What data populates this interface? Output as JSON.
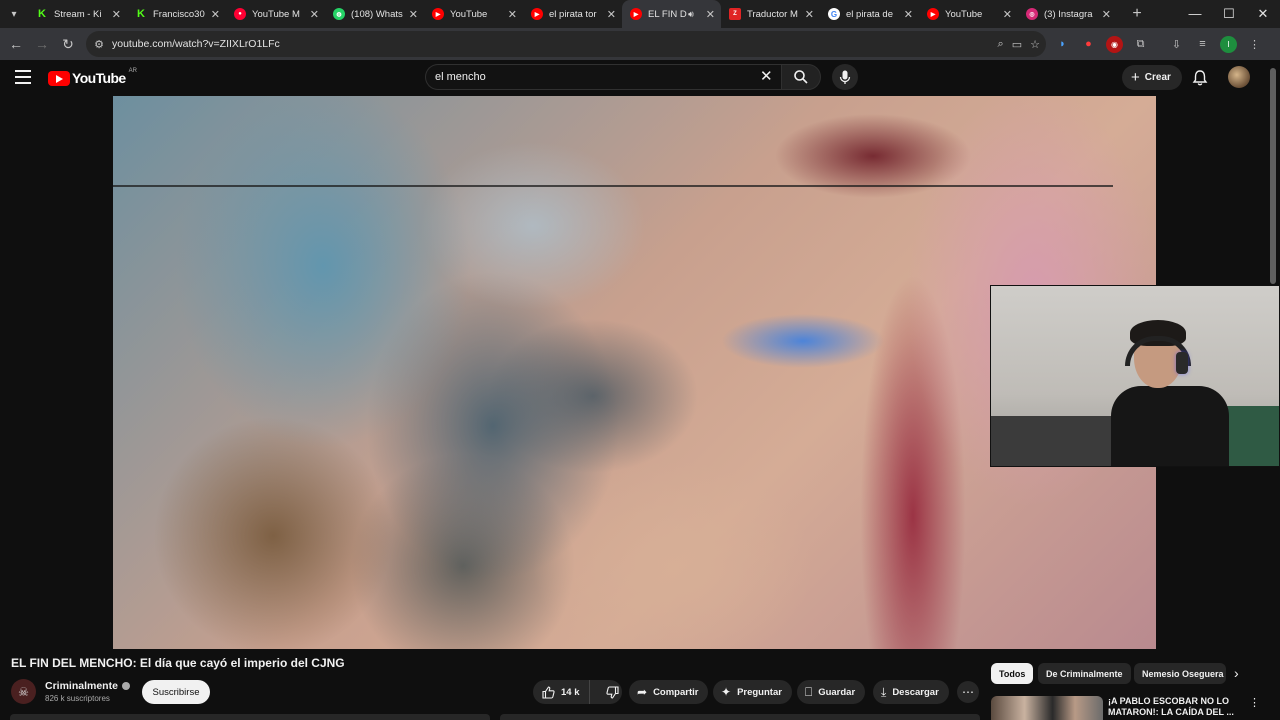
{
  "browser": {
    "tabs": [
      {
        "title": "Stream - Ki",
        "icon": "kick-icon",
        "color": "#53fc18"
      },
      {
        "title": "Francisco30",
        "icon": "kick-icon",
        "color": "#53fc18"
      },
      {
        "title": "YouTube M",
        "icon": "youtube-music-icon",
        "color": "#ff0033"
      },
      {
        "title": "(108) Whats",
        "icon": "whatsapp-icon",
        "color": "#25d366"
      },
      {
        "title": "YouTube",
        "icon": "youtube-icon",
        "color": "#ff0000"
      },
      {
        "title": "el pirata tor",
        "icon": "youtube-icon",
        "color": "#ff0000"
      },
      {
        "title": "EL FIN D",
        "icon": "youtube-icon",
        "color": "#ff0000",
        "active": true,
        "audio": true
      },
      {
        "title": "Traductor M",
        "icon": "translator-icon",
        "color": "#e02424"
      },
      {
        "title": "el pirata de",
        "icon": "google-icon",
        "color": "#4285f4"
      },
      {
        "title": "YouTube",
        "icon": "youtube-icon",
        "color": "#ff0000"
      },
      {
        "title": "(3) Instagra",
        "icon": "instagram-icon",
        "color": "#d62976"
      }
    ],
    "url": "youtube.com/watch?v=ZIIXLrO1LFc"
  },
  "header": {
    "logo_text": "YouTube",
    "country_code": "AR",
    "search_value": "el mencho",
    "create_label": "Crear"
  },
  "video": {
    "title": "EL FIN DEL MENCHO: El día que cayó el imperio del CJNG",
    "channel": "Criminalmente",
    "subscribers": "826 k suscriptores",
    "subscribe_label": "Suscribirse",
    "likes": "14 k",
    "actions": {
      "share": "Compartir",
      "ask": "Preguntar",
      "save": "Guardar",
      "download": "Descargar"
    }
  },
  "sidebar": {
    "chips": [
      "Todos",
      "De Criminalmente",
      "Nemesio Oseguera"
    ],
    "recommendation_title": "¡A PABLO ESCOBAR NO LO MATARON!: LA CAÍDA DEL ..."
  },
  "colors": {
    "youtube_red": "#ff0000",
    "background": "#0f0f0f",
    "chip_bg": "#272727"
  }
}
